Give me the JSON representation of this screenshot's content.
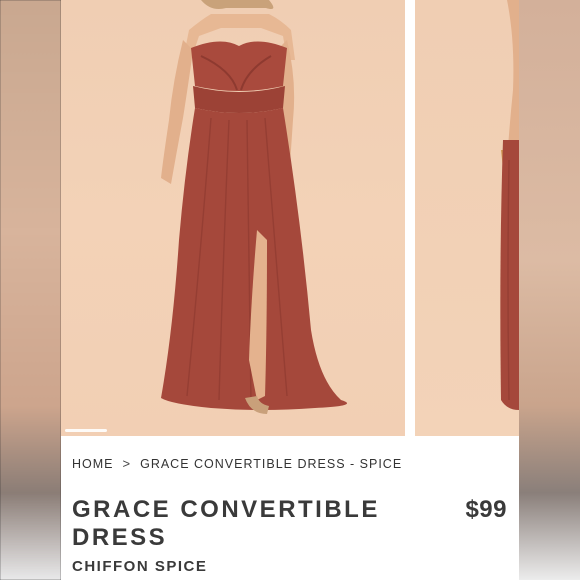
{
  "product": {
    "breadcrumb": {
      "home": "HOME",
      "separator": ">",
      "current": "GRACE CONVERTIBLE DRESS - SPICE"
    },
    "title": "GRACE CONVERTIBLE DRESS",
    "price": "$99",
    "subtitle": "CHIFFON SPICE"
  },
  "gallery": {
    "images": [
      "model-front-photo",
      "model-side-photo"
    ],
    "dress_color": "#a5483b",
    "backdrop_color": "#f2d0b5"
  }
}
